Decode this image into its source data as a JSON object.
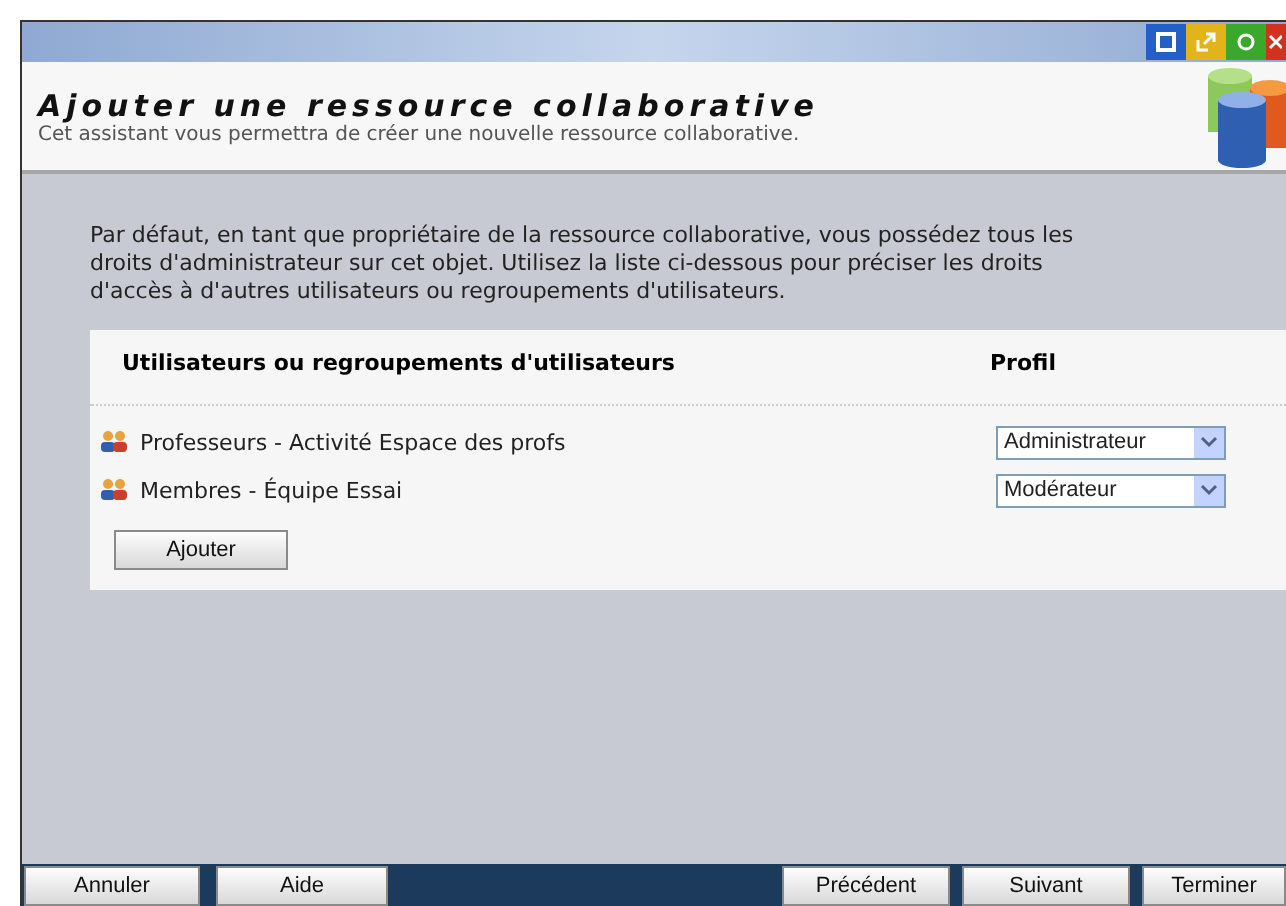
{
  "header": {
    "title": "Ajouter une ressource collaborative",
    "subtitle": "Cet assistant vous permettra de créer une nouvelle ressource collaborative."
  },
  "intro": "Par défaut, en tant que propriétaire de la ressource collaborative, vous possédez tous les droits d'administrateur sur cet objet. Utilisez la liste ci-dessous pour préciser les droits d'accès à d'autres utilisateurs ou regroupements d'utilisateurs.",
  "table": {
    "columns": [
      "Utilisateurs ou regroupements d'utilisateurs",
      "Profil"
    ],
    "rows": [
      {
        "name": "Professeurs - Activité Espace des profs",
        "profile": "Administrateur"
      },
      {
        "name": "Membres - Équipe Essai",
        "profile": "Modérateur"
      }
    ]
  },
  "add_button": "Ajouter",
  "footer": {
    "left": [
      "Annuler",
      "Aide"
    ],
    "right": [
      "Précédent",
      "Suivant",
      "Terminer"
    ]
  }
}
